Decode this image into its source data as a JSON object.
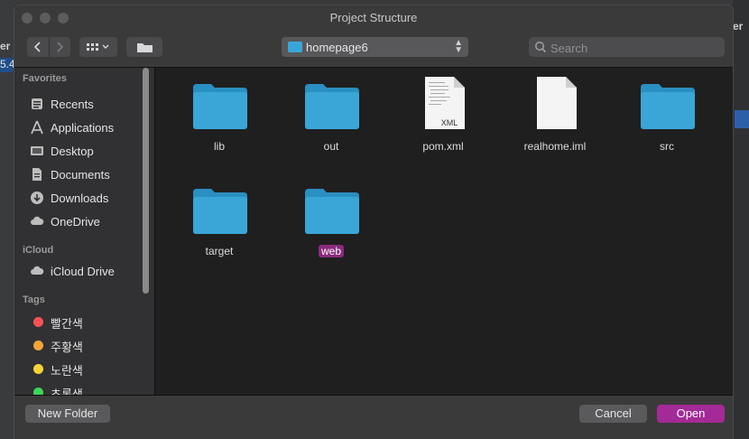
{
  "window": {
    "title": "Project Structure"
  },
  "background_app": {
    "left_text_1": "er",
    "left_text_2": "5.4"
  },
  "toolbar": {
    "back_label": "‹",
    "forward_label": "›",
    "location": "homepage6",
    "search_placeholder": "Search"
  },
  "sidebar": {
    "favorites_heading": "Favorites",
    "favorites": [
      {
        "label": "Recents",
        "icon": "clock-icon"
      },
      {
        "label": "Applications",
        "icon": "applications-icon"
      },
      {
        "label": "Desktop",
        "icon": "desktop-icon"
      },
      {
        "label": "Documents",
        "icon": "documents-icon"
      },
      {
        "label": "Downloads",
        "icon": "downloads-icon"
      },
      {
        "label": "OneDrive",
        "icon": "cloud-icon"
      }
    ],
    "icloud_heading": "iCloud",
    "icloud": [
      {
        "label": "iCloud Drive",
        "icon": "cloud-icon"
      }
    ],
    "tags_heading": "Tags",
    "tags": [
      {
        "label": "빨간색",
        "color": "#ff5257"
      },
      {
        "label": "주황색",
        "color": "#f6a33c"
      },
      {
        "label": "노란색",
        "color": "#f7d435"
      },
      {
        "label": "초록색",
        "color": "#3ed65a"
      }
    ]
  },
  "files": [
    {
      "name": "lib",
      "kind": "folder"
    },
    {
      "name": "out",
      "kind": "folder"
    },
    {
      "name": "pom.xml",
      "kind": "xml",
      "badge": "XML"
    },
    {
      "name": "realhome.iml",
      "kind": "doc"
    },
    {
      "name": "src",
      "kind": "folder"
    },
    {
      "name": "target",
      "kind": "folder"
    },
    {
      "name": "web",
      "kind": "folder",
      "selected": true
    }
  ],
  "buttons": {
    "new_folder": "New Folder",
    "cancel": "Cancel",
    "open": "Open"
  },
  "colors": {
    "accent": "#a32a97",
    "selection": "#8b2a7c",
    "folder": "#3aa6d8"
  }
}
